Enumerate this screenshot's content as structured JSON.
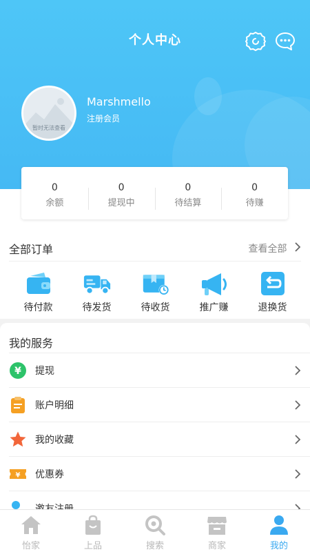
{
  "header": {
    "title": "个人中心",
    "settings_icon": "gear-icon",
    "message_icon": "chat-icon"
  },
  "profile": {
    "avatar_caption": "暂时无法查看",
    "username": "Marshmello",
    "member_level": "注册会员"
  },
  "stats": [
    {
      "value": "0",
      "label": "余额"
    },
    {
      "value": "0",
      "label": "提现中"
    },
    {
      "value": "0",
      "label": "待结算"
    },
    {
      "value": "0",
      "label": "待赚"
    }
  ],
  "orders": {
    "title": "全部订单",
    "view_all": "查看全部",
    "items": [
      {
        "label": "待付款",
        "icon": "wallet-icon"
      },
      {
        "label": "待发货",
        "icon": "truck-icon"
      },
      {
        "label": "待收货",
        "icon": "package-clock-icon"
      },
      {
        "label": "推广赚",
        "icon": "megaphone-icon"
      },
      {
        "label": "退换货",
        "icon": "return-icon"
      }
    ]
  },
  "services": {
    "title": "我的服务",
    "items": [
      {
        "label": "提现",
        "icon": "yuan-circle-icon"
      },
      {
        "label": "账户明细",
        "icon": "clipboard-icon"
      },
      {
        "label": "我的收藏",
        "icon": "star-icon"
      },
      {
        "label": "优惠券",
        "icon": "coupon-icon"
      },
      {
        "label": "邀友注册",
        "icon": "invite-icon"
      }
    ]
  },
  "tabbar": {
    "items": [
      {
        "label": "怡家",
        "icon": "home-icon",
        "active": false
      },
      {
        "label": "上品",
        "icon": "shopping-bag-icon",
        "active": false
      },
      {
        "label": "搜索",
        "icon": "search-icon",
        "active": false
      },
      {
        "label": "商家",
        "icon": "store-icon",
        "active": false
      },
      {
        "label": "我的",
        "icon": "user-icon",
        "active": true
      }
    ]
  },
  "colors": {
    "brand_blue": "#45b9f4",
    "active_tab": "#3aa9f0",
    "green": "#2dc36a",
    "orange": "#f5a023",
    "red_star": "#f2663a"
  }
}
